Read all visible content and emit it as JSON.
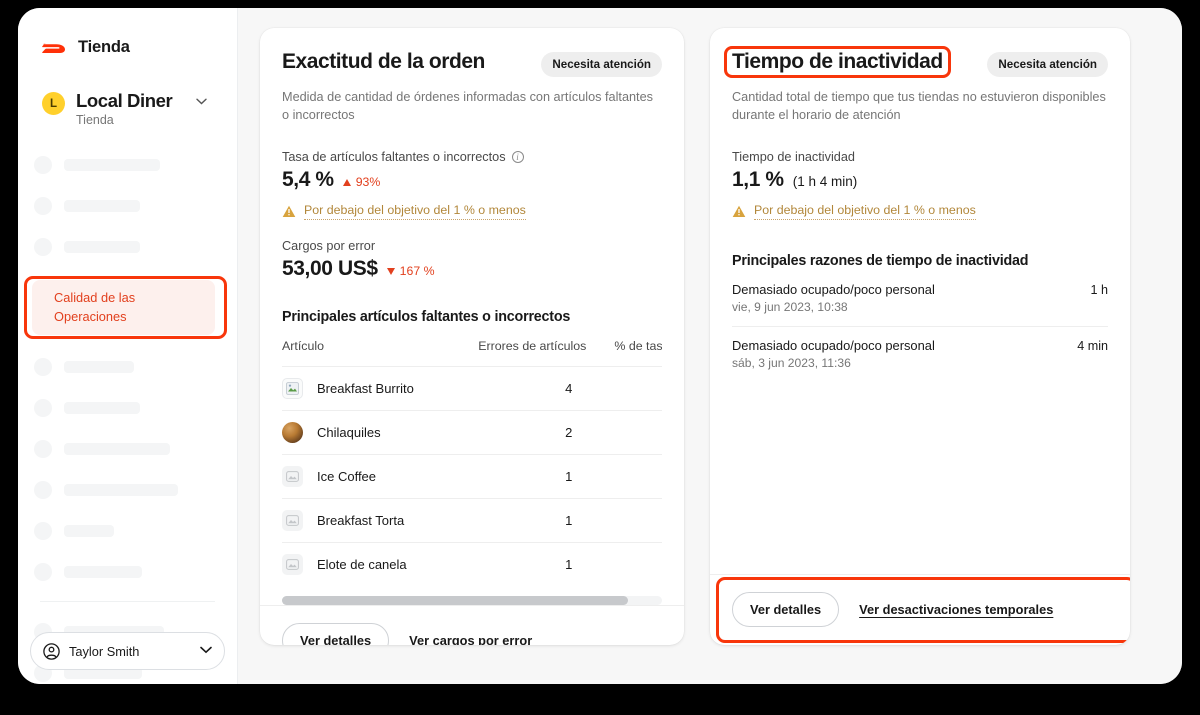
{
  "sidebar": {
    "brand": {
      "label": "Tienda",
      "logo_icon": "doordash-logo-icon"
    },
    "store": {
      "initial": "L",
      "name": "Local Diner",
      "subtitle": "Tienda",
      "chevron_icon": "chevron-down-icon"
    },
    "active_item": {
      "label": "Calidad de las Operaciones"
    },
    "skeleton_items_above": [
      96,
      76,
      76
    ],
    "skeleton_items_below": [
      70,
      76,
      106,
      114,
      50,
      78
    ],
    "skeleton_items_footer": [
      100,
      78
    ],
    "user": {
      "name": "Taylor Smith",
      "icon": "user-circle-icon",
      "chevron_icon": "chevron-down-icon"
    }
  },
  "order_accuracy": {
    "title": "Exactitud de la orden",
    "badge": "Necesita atención",
    "description": "Medida de cantidad de órdenes informadas con artículos faltantes o incorrectos",
    "metric1": {
      "label": "Tasa de artículos faltantes o incorrectos",
      "info_icon": "info-icon",
      "value": "5,4 %",
      "delta": "93%",
      "direction": "up"
    },
    "warning": {
      "icon": "warning-triangle-icon",
      "text": "Por debajo del objetivo del 1 % o menos"
    },
    "metric2": {
      "label": "Cargos por error",
      "value": "53,00 US$",
      "delta": "167 %",
      "direction": "down"
    },
    "table": {
      "title": "Principales artículos faltantes o incorrectos",
      "headers": [
        "Artículo",
        "Errores de artículos",
        "% de tasa de errores de"
      ],
      "rows": [
        {
          "name": "Breakfast Burrito",
          "errors": "4",
          "rate": "",
          "thumb": "broken-image-icon"
        },
        {
          "name": "Chilaquiles",
          "errors": "2",
          "rate": "",
          "thumb": "food-photo"
        },
        {
          "name": "Ice Coffee",
          "errors": "1",
          "rate": "",
          "thumb": "image-placeholder-icon"
        },
        {
          "name": "Breakfast Torta",
          "errors": "1",
          "rate": "",
          "thumb": "image-placeholder-icon"
        },
        {
          "name": "Elote de canela",
          "errors": "1",
          "rate": "",
          "thumb": "image-placeholder-icon"
        }
      ]
    },
    "footer": {
      "button": "Ver detalles",
      "link": "Ver cargos por error"
    }
  },
  "downtime": {
    "title": "Tiempo de inactividad",
    "badge": "Necesita atención",
    "description": "Cantidad total de tiempo que tus tiendas no estuvieron disponibles durante el horario de atención",
    "metric": {
      "label": "Tiempo de inactividad",
      "value": "1,1 %",
      "detail": "(1 h 4 min)"
    },
    "warning": {
      "icon": "warning-triangle-icon",
      "text": "Por debajo del objetivo del 1 % o menos"
    },
    "reasons_title": "Principales razones de tiempo de inactividad",
    "reasons": [
      {
        "name": "Demasiado ocupado/poco personal",
        "date": "vie, 9 jun 2023, 10:38",
        "duration": "1 h"
      },
      {
        "name": "Demasiado ocupado/poco personal",
        "date": "sáb, 3 jun 2023, 11:36",
        "duration": "4 min"
      }
    ],
    "footer": {
      "button": "Ver detalles",
      "link": "Ver desactivaciones temporales"
    }
  },
  "colors": {
    "accent": "#f8360b",
    "brand_red": "#e2401e",
    "warning": "#b2873a",
    "avatar": "#ffd02c"
  }
}
